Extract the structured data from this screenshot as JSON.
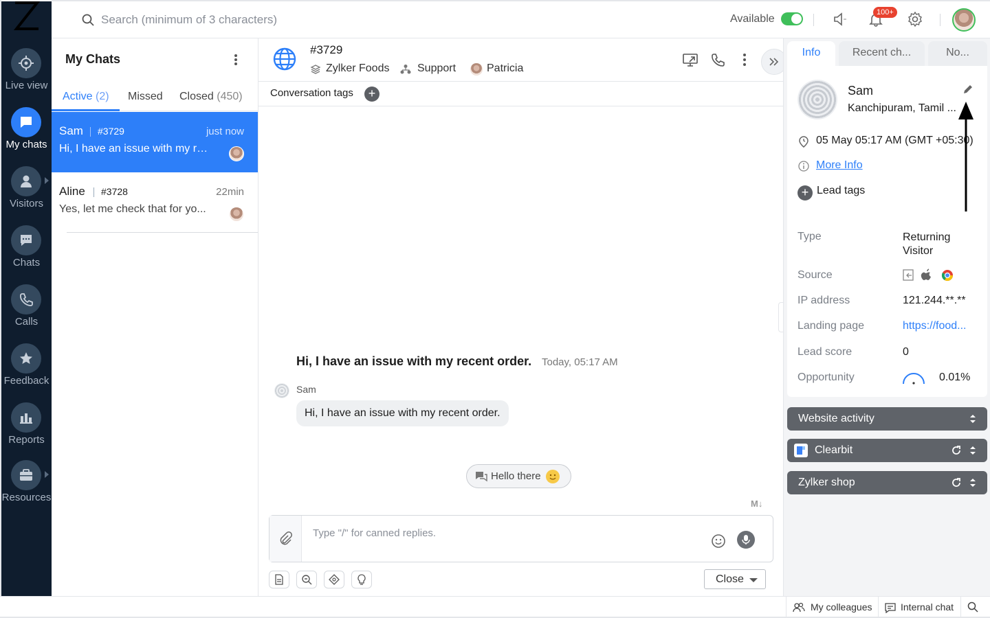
{
  "brand": {
    "logo": "Z"
  },
  "nav": {
    "items": [
      {
        "label": "Live view",
        "icon": "crosshair-icon"
      },
      {
        "label": "My chats",
        "icon": "chat-bubble-icon",
        "active": true
      },
      {
        "label": "Visitors",
        "icon": "person-icon"
      },
      {
        "label": "Chats",
        "icon": "chat-icon"
      },
      {
        "label": "Calls",
        "icon": "phone-icon"
      },
      {
        "label": "Feedback",
        "icon": "star-icon"
      },
      {
        "label": "Reports",
        "icon": "bar-chart-icon"
      },
      {
        "label": "Resources",
        "icon": "briefcase-icon"
      }
    ]
  },
  "topbar": {
    "search_placeholder": "Search (minimum of 3 characters)",
    "availability": "Available",
    "notification_badge": "100+"
  },
  "chatlist": {
    "title": "My Chats",
    "tabs": [
      {
        "label": "Active",
        "count": "(2)"
      },
      {
        "label": "Missed",
        "count": ""
      },
      {
        "label": "Closed",
        "count": "(450)"
      }
    ],
    "items": [
      {
        "name": "Sam",
        "id": "#3729",
        "time": "just now",
        "message": "Hi, I have an issue with my re..."
      },
      {
        "name": "Aline",
        "id": "#3728",
        "time": "22min",
        "message": "Yes, let me check that for yo..."
      }
    ]
  },
  "conversation": {
    "id": "#3729",
    "company": "Zylker Foods",
    "department": "Support",
    "agent": "Patricia",
    "tags_label": "Conversation tags",
    "first_message": "Hi, I have an issue with my recent order.",
    "first_message_time": "Today, 05:17 AM",
    "sender": "Sam",
    "bubble_text": "Hi, I have an issue with my recent order.",
    "hello_chip": "Hello there",
    "markdown_label": "M↓",
    "composer_placeholder": "Type \"/\" for canned replies.",
    "close_label": "Close"
  },
  "info": {
    "tabs": [
      "Info",
      "Recent ch...",
      "No..."
    ],
    "name": "Sam",
    "location": "Kanchipuram, Tamil ...",
    "local_time": "05 May 05:17 AM  (GMT +05:30)",
    "more_info": "More Info",
    "lead_tags": "Lead tags",
    "fields": [
      {
        "key": "Type",
        "value": "Returning Visitor"
      },
      {
        "key": "Source",
        "value": ""
      },
      {
        "key": "IP address",
        "value": "121.244.**.**"
      },
      {
        "key": "Landing page",
        "value": "https://food..."
      },
      {
        "key": "Lead score",
        "value": "0"
      },
      {
        "key": "Opportunity",
        "value": "0.01%"
      }
    ],
    "sections": [
      "Website activity",
      "Clearbit",
      "Zylker shop"
    ]
  },
  "bottombar": {
    "colleagues": "My colleagues",
    "internal_chat": "Internal chat"
  },
  "colors": {
    "accent": "#2d7ff9",
    "nav_bg": "#0f1d2e",
    "available": "#3fbf5a",
    "badge": "#e8422f"
  }
}
